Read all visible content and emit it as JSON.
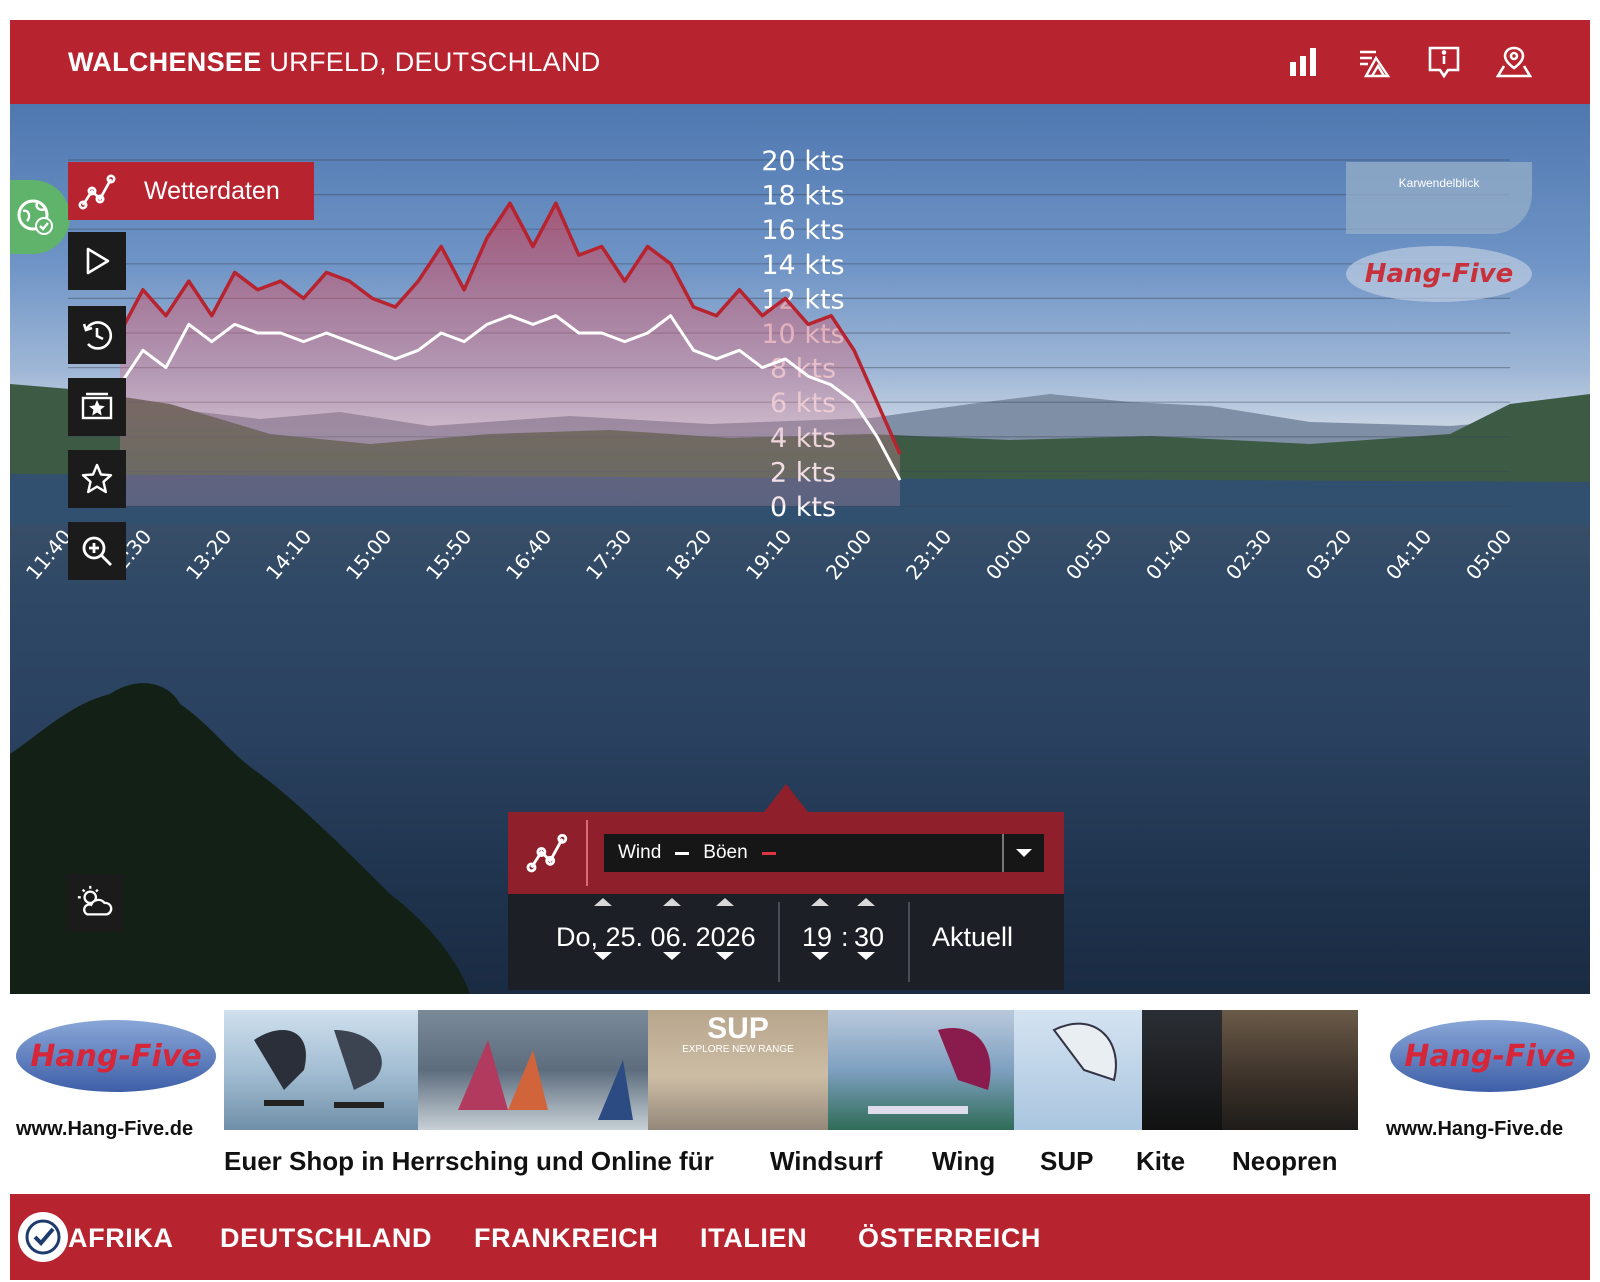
{
  "header": {
    "title_bold": "WALCHENSEE",
    "title_rest": "URFELD, DEUTSCHLAND",
    "icons": [
      "bar-chart-icon",
      "wind-map-icon",
      "info-icon",
      "location-icon"
    ]
  },
  "sidebar": {
    "wetterdaten_label": "Wetterdaten",
    "buttons": [
      "play-icon",
      "history-icon",
      "gallery-icon",
      "favorite-icon",
      "zoom-icon"
    ],
    "weather_button": "weather-icon"
  },
  "chart_data": {
    "type": "area",
    "ylabel": "",
    "yunit": "kts",
    "ylim": [
      0,
      20
    ],
    "ytick_labels": [
      "0 kts",
      "2 kts",
      "4 kts",
      "6 kts",
      "8 kts",
      "10 kts",
      "12 kts",
      "14 kts",
      "16 kts",
      "18 kts",
      "20 kts"
    ],
    "x_tick_labels": [
      "11:40",
      "12:30",
      "13:20",
      "14:10",
      "15:00",
      "15:50",
      "16:40",
      "17:30",
      "18:20",
      "19:10",
      "20:00",
      "23:10",
      "00:00",
      "00:50",
      "01:40",
      "02:30",
      "03:20",
      "04:10",
      "05:00"
    ],
    "x": [
      "11:40",
      "12:00",
      "12:20",
      "12:30",
      "12:50",
      "13:10",
      "13:20",
      "13:40",
      "14:00",
      "14:10",
      "14:30",
      "14:50",
      "15:00",
      "15:20",
      "15:40",
      "15:50",
      "16:10",
      "16:30",
      "16:40",
      "17:00",
      "17:20",
      "17:30",
      "17:50",
      "18:10",
      "18:20",
      "18:40",
      "19:00",
      "19:10",
      "19:20",
      "19:30",
      "19:40",
      "19:50",
      "20:00",
      "20:10",
      "20:20"
    ],
    "series": [
      {
        "name": "Böen",
        "color": "#b7242f",
        "values": [
          10,
          12.5,
          11,
          13,
          11,
          13.5,
          12.5,
          13,
          12,
          13.5,
          13,
          12,
          11.5,
          13,
          15,
          12.5,
          15.5,
          17.5,
          15,
          17.5,
          14.5,
          15,
          13,
          15,
          14,
          11.5,
          11,
          12.5,
          11,
          12,
          10.5,
          11,
          9,
          6,
          3
        ]
      },
      {
        "name": "Wind",
        "color": "#ffffff",
        "values": [
          7,
          9,
          8,
          10.5,
          9.5,
          10.5,
          10,
          10,
          9.5,
          10,
          9.5,
          9,
          8.5,
          9,
          10,
          9.5,
          10.5,
          11,
          10.5,
          11,
          10,
          10,
          9.5,
          10,
          11,
          9,
          8.5,
          9,
          8,
          8.5,
          7.5,
          7,
          6,
          4,
          1.5
        ]
      }
    ]
  },
  "ads": {
    "top_small": "Karwendelblick",
    "top_logo": "Hang-Five"
  },
  "selector": {
    "wind_label": "Wind",
    "boen_label": "Böen",
    "wind_color": "#ffffff",
    "boen_color": "#e03440"
  },
  "datetime": {
    "date": "Do, 25. 06. 2026",
    "hour": "19",
    "sep": ":",
    "minute": "30",
    "aktuell": "Aktuell"
  },
  "banner": {
    "logo_text": "Hang-Five",
    "url_left": "www.Hang-Five.de",
    "url_right": "www.Hang-Five.de",
    "photo_sup_text": "SUP",
    "photo_sup_sub": "EXPLORE NEW RANGE",
    "caption": "Euer Shop in Herrsching und Online für",
    "categories": [
      "Windsurf",
      "Wing",
      "SUP",
      "Kite",
      "Neopren"
    ]
  },
  "nav": {
    "items": [
      "AFRIKA",
      "DEUTSCHLAND",
      "FRANKREICH",
      "ITALIEN",
      "ÖSTERREICH"
    ]
  }
}
